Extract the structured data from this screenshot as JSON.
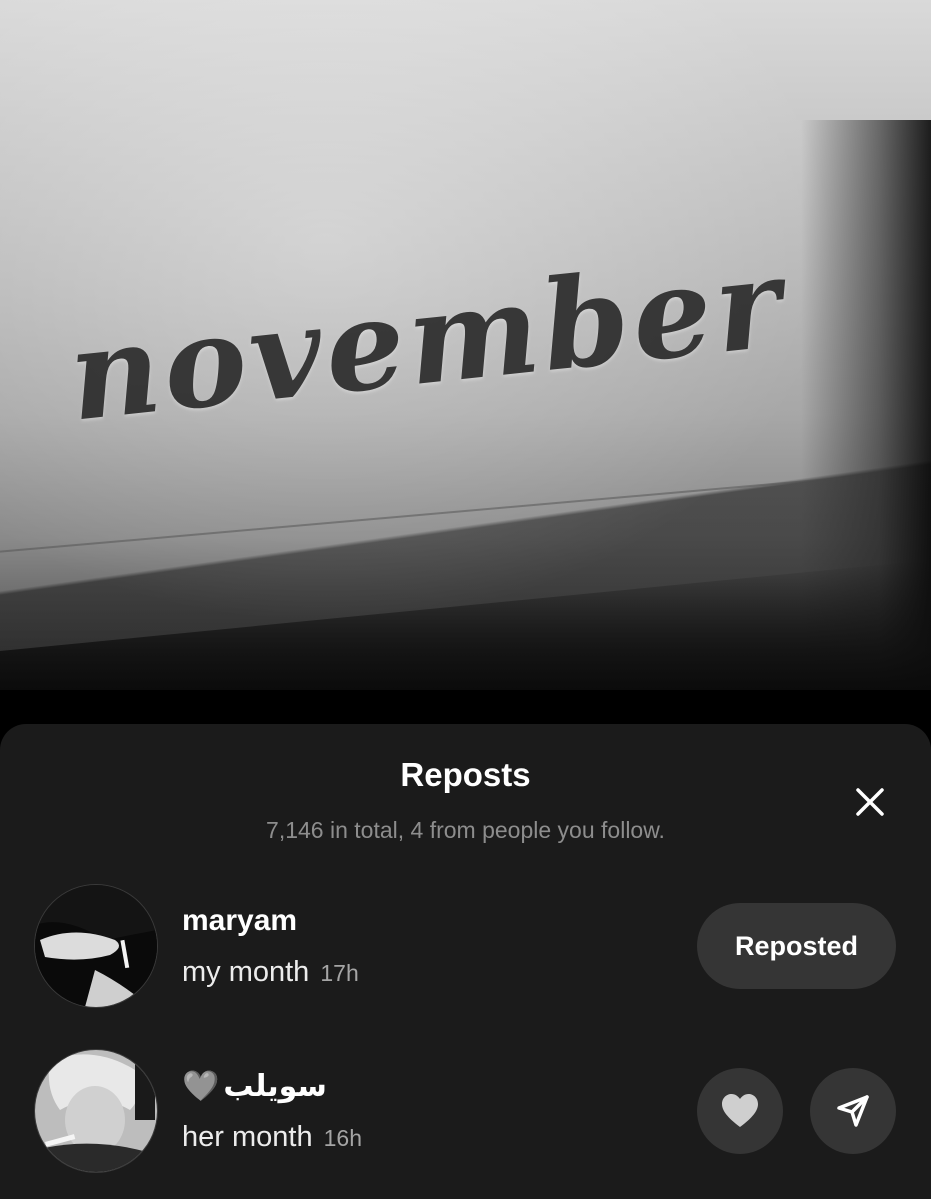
{
  "post_image": {
    "handwritten_word": "november"
  },
  "sheet": {
    "title": "Reposts",
    "subtitle": "7,146 in total, 4 from people you follow.",
    "close_icon": "close-icon"
  },
  "reposts": [
    {
      "name": "maryam",
      "caption": "my month",
      "time": "17h",
      "action_label": "Reposted"
    },
    {
      "name": "سويلب",
      "name_emoji": "🩶",
      "caption": "her month",
      "time": "16h",
      "actions": [
        "heart-icon",
        "send-icon"
      ]
    }
  ],
  "colors": {
    "sheet_background": "#1b1b1b",
    "button_background": "#353535",
    "subtitle_text": "#8d8d8d"
  }
}
